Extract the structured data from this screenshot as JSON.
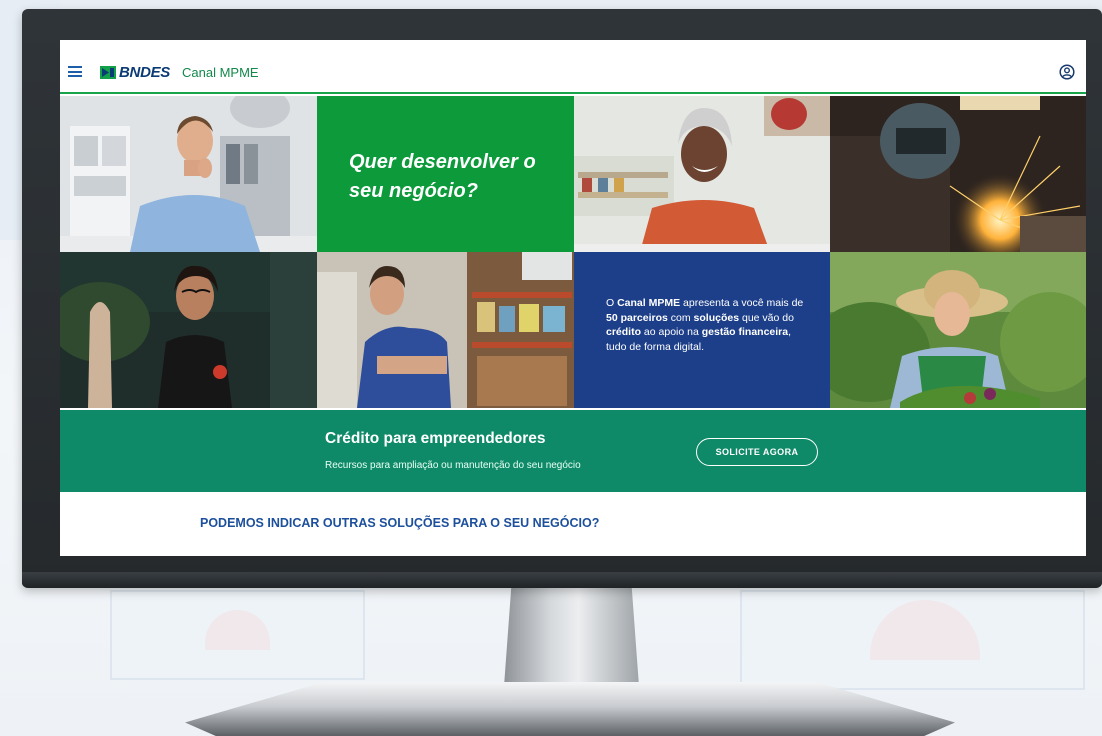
{
  "header": {
    "logo_text": "BNDES",
    "channel_name": "Canal MPME"
  },
  "hero": {
    "headline_line1": "Quer desenvolver o",
    "headline_line2": "seu negócio?",
    "blurb": {
      "p1": "O ",
      "b1": "Canal MPME",
      "p2": " apresenta a você mais de ",
      "b2": "50 parceiros",
      "p3": " com ",
      "b3": "soluções",
      "p4": " que vão do ",
      "b4": "crédito",
      "p5": " ao apoio na ",
      "b5": "gestão financeira",
      "p6": ", tudo de forma digital."
    }
  },
  "banner": {
    "title": "Crédito para empreendedores",
    "subtitle": "Recursos para ampliação ou manutenção do seu negócio",
    "cta_label": "SOLICITE AGORA"
  },
  "section": {
    "title": "PODEMOS INDICAR OUTRAS SOLUÇÕES PARA O SEU NEGÓCIO?"
  },
  "colors": {
    "green": "#0c9a3b",
    "blue": "#1d3f8a",
    "teal": "#0f8a68",
    "brand_navy": "#0b3b74"
  }
}
